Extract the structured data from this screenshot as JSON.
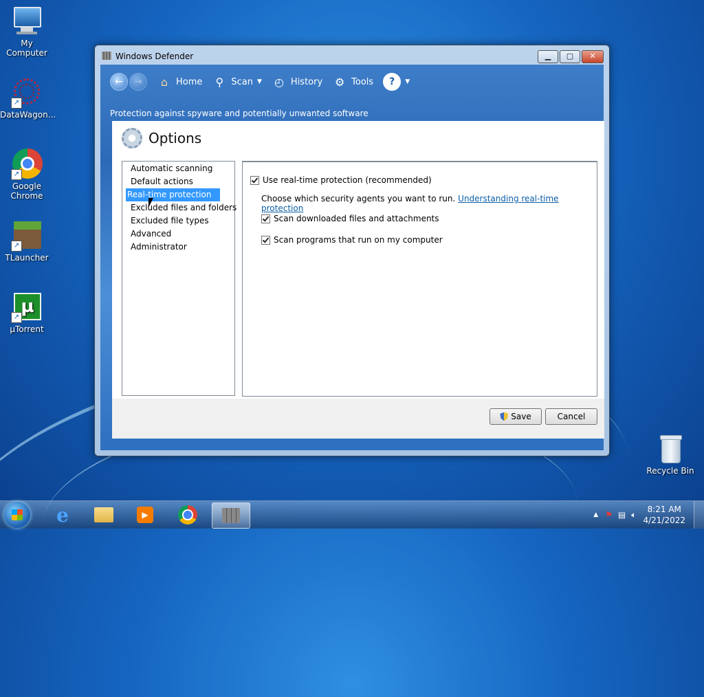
{
  "desktop": {
    "icons": [
      {
        "label": "My Computer"
      },
      {
        "label": "DataWagon..."
      },
      {
        "label": "Google Chrome"
      },
      {
        "label": "TLauncher"
      },
      {
        "label": "µTorrent"
      },
      {
        "label": "Recycle Bin"
      }
    ]
  },
  "window": {
    "title": "Windows Defender",
    "toolbar": {
      "home": "Home",
      "scan": "Scan",
      "history": "History",
      "tools": "Tools"
    },
    "subtitle": "Protection against spyware and potentially unwanted software",
    "options_title": "Options",
    "nav_items": [
      {
        "label": "Automatic scanning"
      },
      {
        "label": "Default actions"
      },
      {
        "label": "Real-time protection",
        "selected": true
      },
      {
        "label": "Excluded files and folders"
      },
      {
        "label": "Excluded file types"
      },
      {
        "label": "Advanced"
      },
      {
        "label": "Administrator"
      }
    ],
    "options": {
      "use_realtime": "Use real-time protection (recommended)",
      "description": "Choose which security agents you want to run.",
      "link": "Understanding real-time protection",
      "scan_downloads": "Scan downloaded files and attachments",
      "scan_programs": "Scan programs that run on my computer"
    },
    "buttons": {
      "save": "Save",
      "cancel": "Cancel"
    }
  },
  "taskbar": {
    "time": "8:21 AM",
    "date": "4/21/2022"
  }
}
